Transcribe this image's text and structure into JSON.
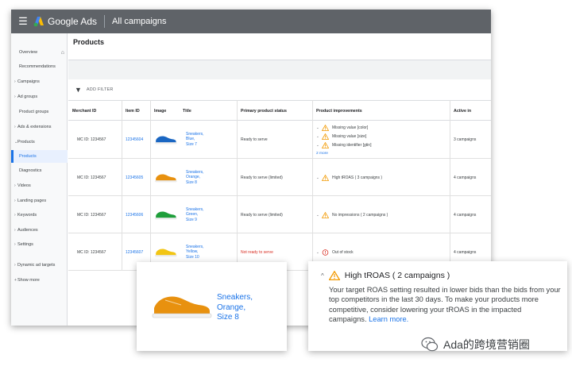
{
  "app": {
    "brand": "Google Ads",
    "breadcrumb": "All campaigns",
    "menu_icon": "hamburger-menu-icon",
    "logo_icon": "google-ads-logo-icon"
  },
  "sidebar": {
    "items": [
      {
        "label": "Overview",
        "sub": true,
        "chevron": false
      },
      {
        "label": "Recommendations",
        "sub": true,
        "chevron": false
      },
      {
        "label": "Campaigns",
        "sub": false,
        "chevron": true
      },
      {
        "label": "Ad groups",
        "sub": false,
        "chevron": true
      },
      {
        "label": "Product groups",
        "sub": true,
        "chevron": false
      },
      {
        "label": "Ads & extensions",
        "sub": false,
        "chevron": true
      },
      {
        "label": "Products",
        "sub": false,
        "chevron": true,
        "expanded": true
      },
      {
        "label": "Products",
        "sub": true,
        "chevron": false,
        "active": true
      },
      {
        "label": "Diagnostics",
        "sub": true,
        "chevron": false
      },
      {
        "label": "Videos",
        "sub": false,
        "chevron": true
      },
      {
        "label": "Landing pages",
        "sub": false,
        "chevron": true
      },
      {
        "label": "Keywords",
        "sub": false,
        "chevron": true
      },
      {
        "label": "Audiences",
        "sub": false,
        "chevron": true
      },
      {
        "label": "Settings",
        "sub": false,
        "chevron": true
      },
      {
        "label": "Dynamic ad targets",
        "sub": false,
        "chevron": true
      },
      {
        "label": "Show more",
        "sub": false,
        "chevron": true,
        "plus": true
      }
    ]
  },
  "main": {
    "title": "Products",
    "filter_label": "ADD FILTER",
    "columns": [
      "Merchant ID",
      "Item ID",
      "Image",
      "Title",
      "Primary product status",
      "Product improvements",
      "Active in"
    ],
    "rows": [
      {
        "merchant_id": "MC ID: 1234567",
        "item_id": "12345604",
        "shoe_color": "#1a66c2",
        "title_lines": [
          "Sneakers,",
          "Blue,",
          "Size 7"
        ],
        "status": "Ready to serve",
        "status_red": false,
        "improvements": [
          {
            "text": "Missing value [color]",
            "icon": "warning"
          },
          {
            "text": "Missing value [size]",
            "icon": "warning"
          },
          {
            "text": "Missing identifier [gtin]",
            "icon": "warning"
          }
        ],
        "more": "2 more",
        "active_in": "3 campaigns"
      },
      {
        "merchant_id": "MC ID: 1234567",
        "item_id": "12345605",
        "shoe_color": "#e8910f",
        "title_lines": [
          "Sneakers,",
          "Orange,",
          "Size 8"
        ],
        "status": "Ready to serve (limited)",
        "status_red": false,
        "improvements": [
          {
            "text": "High tROAS ( 3 campaigns )",
            "icon": "warning"
          }
        ],
        "more": "",
        "active_in": "4 campaigns"
      },
      {
        "merchant_id": "MC ID: 1234567",
        "item_id": "12345606",
        "shoe_color": "#1e9e3a",
        "title_lines": [
          "Sneakers,",
          "Green,",
          "Size 9"
        ],
        "status": "Ready to serve (limited)",
        "status_red": false,
        "improvements": [
          {
            "text": "No impressions ( 2 campaigns )",
            "icon": "warning"
          }
        ],
        "more": "",
        "active_in": "4 campaigns"
      },
      {
        "merchant_id": "MC ID: 1234567",
        "item_id": "12345607",
        "shoe_color": "#f2c514",
        "title_lines": [
          "Sneakers,",
          "Yellow,",
          "Size 10"
        ],
        "status": "Not ready to serve",
        "status_red": true,
        "improvements": [
          {
            "text": "Out of stock",
            "icon": "error"
          }
        ],
        "more": "",
        "active_in": "4 campaigns"
      }
    ]
  },
  "callout_left": {
    "title_lines": [
      "Sneakers,",
      "Orange,",
      "Size 8"
    ],
    "shoe_color": "#e8910f"
  },
  "callout_right": {
    "heading": "High tROAS ( 2 campaigns )",
    "body": "Your target ROAS setting resulted in lower bids than the bids from your top competitors in the last 30 days. To make your products more competitive, consider lowering your tROAS in the impacted campaigns.",
    "link": "Learn more."
  },
  "watermark": {
    "text": "Ada的跨境营销圈",
    "icon": "wechat-icon"
  },
  "colors": {
    "appbar": "#5f6368",
    "link": "#1a73e8",
    "warning": "#f29900",
    "error": "#d93025"
  }
}
